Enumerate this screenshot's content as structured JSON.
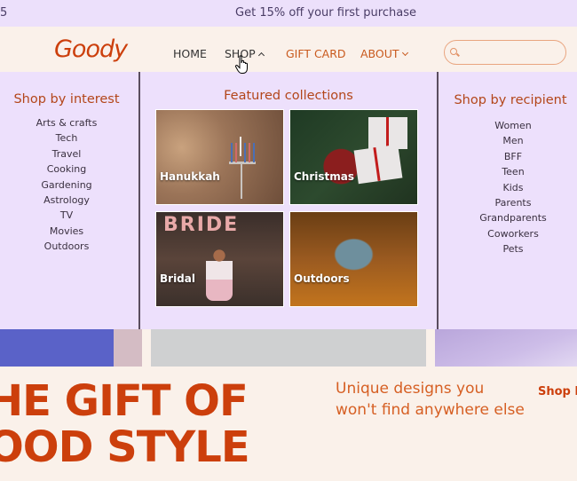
{
  "announcement": {
    "left_fragment": "5",
    "message": "Get 15% off your first purchase"
  },
  "header": {
    "logo": "Goody",
    "nav": [
      {
        "label": "HOME",
        "chevron": "none"
      },
      {
        "label": "SHOP",
        "chevron": "up"
      },
      {
        "label": "GIFT CARD",
        "chevron": "none"
      },
      {
        "label": "ABOUT",
        "chevron": "down"
      }
    ],
    "search": {
      "value": "",
      "placeholder": ""
    }
  },
  "mega_menu": {
    "interest": {
      "title": "Shop by interest",
      "items": [
        "Arts & crafts",
        "Tech",
        "Travel",
        "Cooking",
        "Gardening",
        "Astrology",
        "TV",
        "Movies",
        "Outdoors"
      ]
    },
    "featured": {
      "title": "Featured collections",
      "tiles": [
        {
          "label": "Hanukkah"
        },
        {
          "label": "Christmas"
        },
        {
          "label": "Bridal"
        },
        {
          "label": "Outdoors"
        }
      ]
    },
    "recipient": {
      "title": "Shop by recipient",
      "items": [
        "Women",
        "Men",
        "BFF",
        "Teen",
        "Kids",
        "Parents",
        "Grandparents",
        "Coworkers",
        "Pets"
      ]
    }
  },
  "hero": {
    "title_line1": "HE GIFT OF",
    "title_line2": "OOD STYLE",
    "subtitle_line1": "Unique designs you",
    "subtitle_line2": "won't find anywhere else",
    "cta": "Shop N"
  },
  "colors": {
    "brand": "#cc3f0c",
    "accent": "#c95a1e",
    "announcement_bg": "#ece0fb",
    "menu_bg": "#ede0fc",
    "page_bg": "#faf1ea"
  }
}
